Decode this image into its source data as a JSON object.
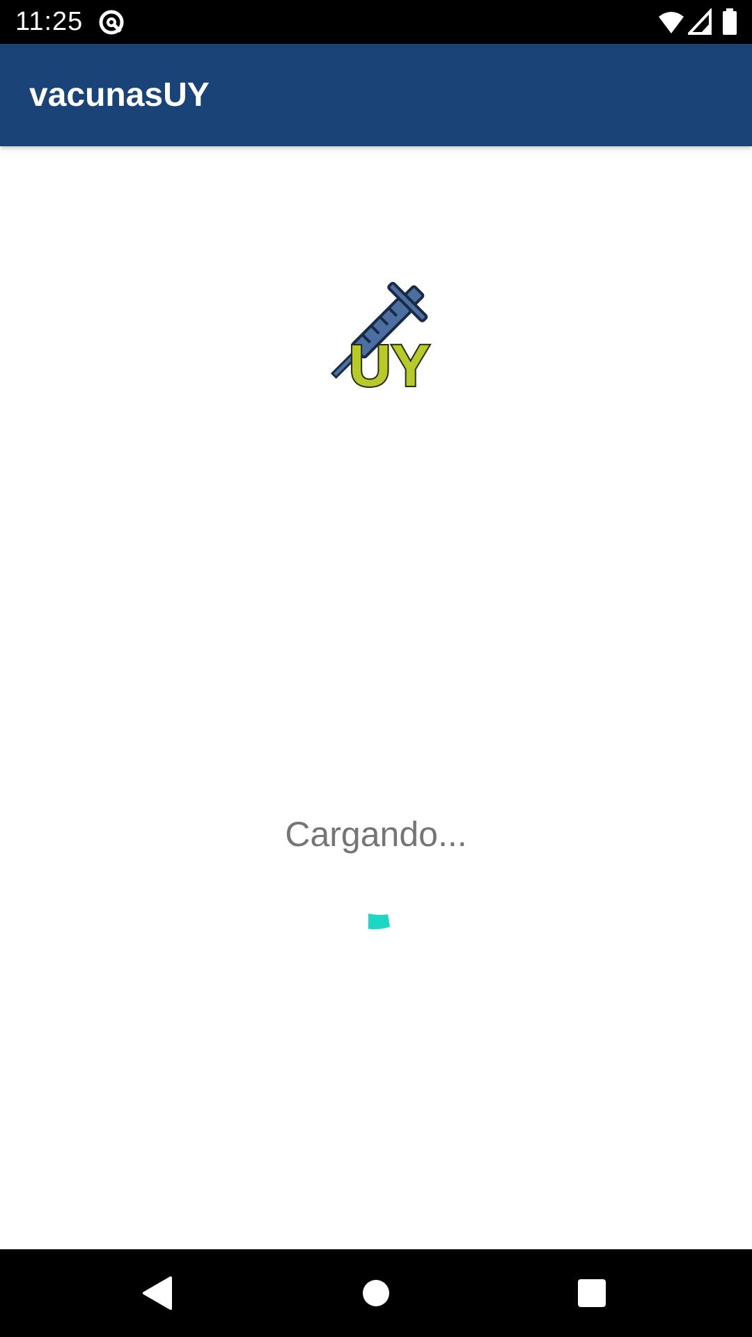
{
  "status_bar": {
    "time": "11:25",
    "icons": [
      "do-not-disturb-icon",
      "wifi-icon",
      "cellular-signal-icon",
      "battery-icon"
    ]
  },
  "app_bar": {
    "title": "vacunasUY",
    "color": "#1a4377"
  },
  "content": {
    "logo_icon": "syringe-uy-logo",
    "logo_text": "UY",
    "loading_text": "Cargando...",
    "spinner_color": "#1fd6c4"
  },
  "nav_bar": {
    "buttons": [
      "back-icon",
      "home-icon",
      "recents-icon"
    ]
  }
}
